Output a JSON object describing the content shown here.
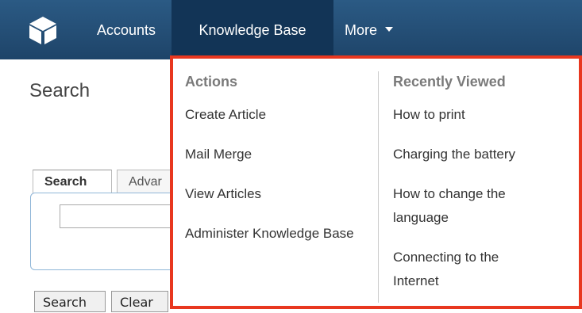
{
  "navbar": {
    "logo_icon": "cube-logo-icon",
    "items": [
      {
        "label": "Accounts"
      },
      {
        "label": "Knowledge Base"
      },
      {
        "label": "More"
      }
    ],
    "colors": {
      "bar": "#1e4469",
      "active": "#123456"
    }
  },
  "page": {
    "title": "Search",
    "tabs": [
      {
        "label": "Search"
      },
      {
        "label": "Advar"
      }
    ],
    "search_input": {
      "value": "",
      "placeholder": ""
    },
    "buttons": {
      "search_label": "Search",
      "clear_label": "Clear"
    }
  },
  "menu": {
    "border_color": "#e8371f",
    "actions": {
      "header": "Actions",
      "items": [
        {
          "label": "Create Article"
        },
        {
          "label": "Mail Merge"
        },
        {
          "label": "View Articles"
        },
        {
          "label": "Administer Knowledge Base"
        }
      ]
    },
    "recent": {
      "header": "Recently Viewed",
      "items": [
        {
          "label": "How to print"
        },
        {
          "label": "Charging the battery"
        },
        {
          "label": "How to change the language"
        },
        {
          "label": "Connecting to the Internet"
        }
      ]
    }
  }
}
